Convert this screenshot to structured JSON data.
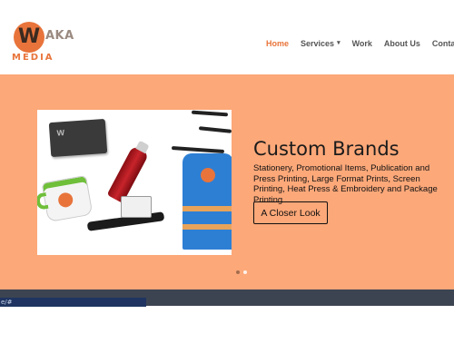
{
  "logo": {
    "mark": "W",
    "suffix": "AKA",
    "subtitle": "MEDIA"
  },
  "nav": {
    "home": "Home",
    "services": "Services",
    "services_chevron": "▾",
    "work": "Work",
    "about": "About Us",
    "contact": "Contact U"
  },
  "hero": {
    "title": "Custom Brands",
    "description": "Stationery, Promotional Items, Publication and Press Printing, Large Format Prints, Screen Printing, Heat Press & Embroidery and Package Printing",
    "cta_label": "A Closer Look",
    "image_card_text": "W",
    "slides": 2,
    "active_slide": 2
  },
  "status_bar": {
    "url": "e/#"
  },
  "colors": {
    "accent": "#e8743b",
    "hero_bg": "#fca879",
    "strip": "#3c4452",
    "status_bg": "#1f3460"
  }
}
